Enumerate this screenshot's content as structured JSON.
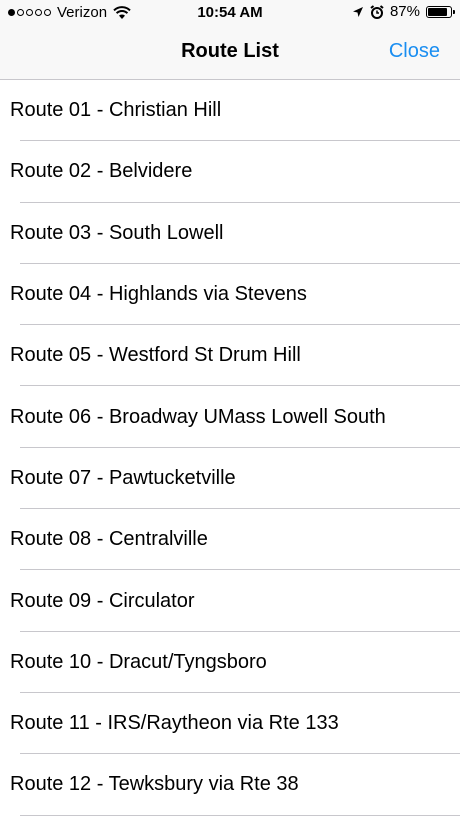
{
  "status_bar": {
    "carrier": "Verizon",
    "time": "10:54 AM",
    "battery": "87%",
    "battery_level": 0.87
  },
  "nav": {
    "title": "Route List",
    "close_label": "Close"
  },
  "routes": [
    "Route 01 - Christian Hill",
    "Route 02 - Belvidere",
    "Route 03 - South Lowell",
    "Route 04 - Highlands via Stevens",
    "Route 05 - Westford St Drum Hill",
    "Route 06 - Broadway UMass Lowell South",
    "Route 07 - Pawtucketville",
    "Route 08 - Centralville",
    "Route 09 - Circulator",
    "Route 10 - Dracut/Tyngsboro",
    "Route 11 - IRS/Raytheon via Rte 133",
    "Route 12 - Tewksbury via Rte 38"
  ],
  "colors": {
    "accent": "#1a8ef1",
    "separator": "#c8c7cc",
    "bar_background": "#f8f8f8"
  }
}
